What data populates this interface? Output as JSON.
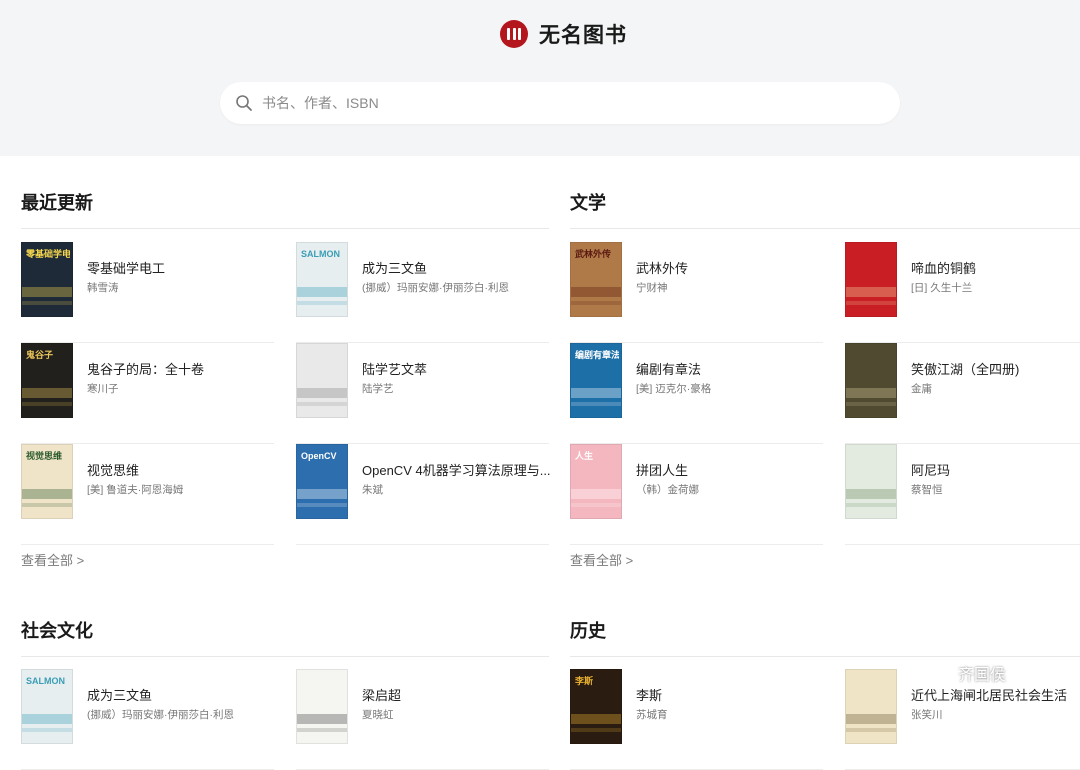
{
  "brand": {
    "name": "无名图书",
    "logo_icon": "books-logo-icon",
    "color": "#b3161c"
  },
  "search": {
    "placeholder": "书名、作者、ISBN"
  },
  "sections": {
    "latest": {
      "title": "最近更新",
      "view_all": "查看全部 >",
      "books": [
        {
          "title": "零基础学电工",
          "author": "韩雪涛",
          "cover_text": "零基础学电工",
          "cover_bg": "#1f2a38",
          "cover_fg": "#f4d64e"
        },
        {
          "title": "成为三文鱼",
          "author": "(挪威）玛丽安娜·伊丽莎白·利恩",
          "cover_text": "SALMON",
          "cover_bg": "#e7eef0",
          "cover_fg": "#3a9db6"
        },
        {
          "title": "鬼谷子的局：全十卷",
          "author": "寒川子",
          "cover_text": "鬼谷子",
          "cover_bg": "#22201c",
          "cover_fg": "#e8c55a"
        },
        {
          "title": "陆学艺文萃",
          "author": "陆学艺",
          "cover_text": "",
          "cover_bg": "#e9e9e9",
          "cover_fg": "#888888"
        },
        {
          "title": "视觉思维",
          "author": "[美] 鲁道夫·阿恩海姆",
          "cover_text": "视觉思维",
          "cover_bg": "#efe3c8",
          "cover_fg": "#2c5b2e"
        },
        {
          "title": "OpenCV 4机器学习算法原理与...",
          "author": "朱斌",
          "cover_text": "OpenCV",
          "cover_bg": "#2d6fae",
          "cover_fg": "#ffffff"
        }
      ]
    },
    "literature": {
      "title": "文学",
      "view_all": "查看全部 >",
      "books": [
        {
          "title": "武林外传",
          "author": "宁财神",
          "cover_text": "武林外传",
          "cover_bg": "#b07a48",
          "cover_fg": "#5b1a12"
        },
        {
          "title": "啼血的铜鹤",
          "author": "[日] 久生十兰",
          "cover_text": "",
          "cover_bg": "#c81e24",
          "cover_fg": "#f6d8a0"
        },
        {
          "title": "编剧有章法",
          "author": "[美] 迈克尔·豪格",
          "cover_text": "编剧有章法",
          "cover_bg": "#1d6fa8",
          "cover_fg": "#ffffff"
        },
        {
          "title": "笑傲江湖（全四册)",
          "author": "金庸",
          "cover_text": "",
          "cover_bg": "#4f4a30",
          "cover_fg": "#d8c89a"
        },
        {
          "title": "拼团人生",
          "author": "（韩）金荷娜",
          "cover_text": "人生",
          "cover_bg": "#f4b7bf",
          "cover_fg": "#ffffff"
        },
        {
          "title": "阿尼玛",
          "author": "蔡智恒",
          "cover_text": "",
          "cover_bg": "#e3ebe0",
          "cover_fg": "#6a8a62"
        }
      ]
    },
    "society": {
      "title": "社会文化",
      "books": [
        {
          "title": "成为三文鱼",
          "author": "(挪威）玛丽安娜·伊丽莎白·利恩",
          "cover_text": "SALMON",
          "cover_bg": "#e7eef0",
          "cover_fg": "#3a9db6"
        },
        {
          "title": "梁启超",
          "author": "夏晓虹",
          "cover_text": "",
          "cover_bg": "#f5f5f2",
          "cover_fg": "#444444"
        }
      ]
    },
    "history": {
      "title": "历史",
      "books": [
        {
          "title": "李斯",
          "author": "苏城育",
          "cover_text": "李斯",
          "cover_bg": "#2b1c12",
          "cover_fg": "#e9b230"
        },
        {
          "title": "近代上海闸北居民社会生活",
          "author": "张笑川",
          "cover_text": "",
          "cover_bg": "#efe4c6",
          "cover_fg": "#6b5a33"
        }
      ]
    }
  },
  "watermark": {
    "text": "齐国侯",
    "icon": "wechat-icon"
  }
}
